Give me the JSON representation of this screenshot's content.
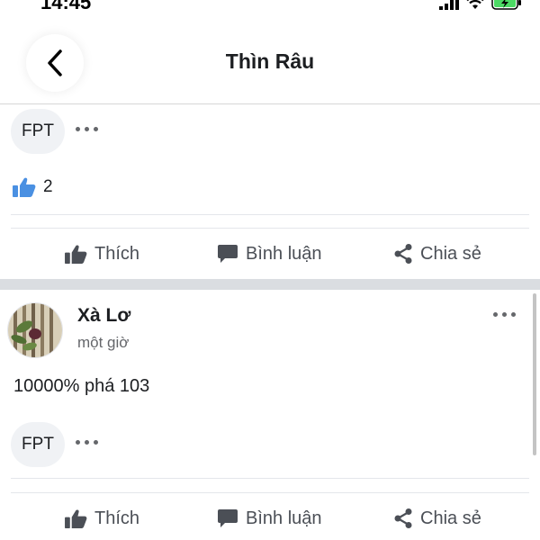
{
  "status_bar": {
    "time": "14:45"
  },
  "header": {
    "title": "Thìn Râu"
  },
  "post1": {
    "reaction_label": "FPT",
    "like_count": "2"
  },
  "actions": {
    "like": "Thích",
    "comment": "Bình luận",
    "share": "Chia sẻ"
  },
  "post2": {
    "author": "Xà Lơ",
    "time": "một giờ",
    "text": "10000% phá 103",
    "reaction_label": "FPT"
  },
  "colors": {
    "like_blue": "#4a90e2",
    "battery_green": "#4cd964",
    "separator": "#dadde1"
  }
}
